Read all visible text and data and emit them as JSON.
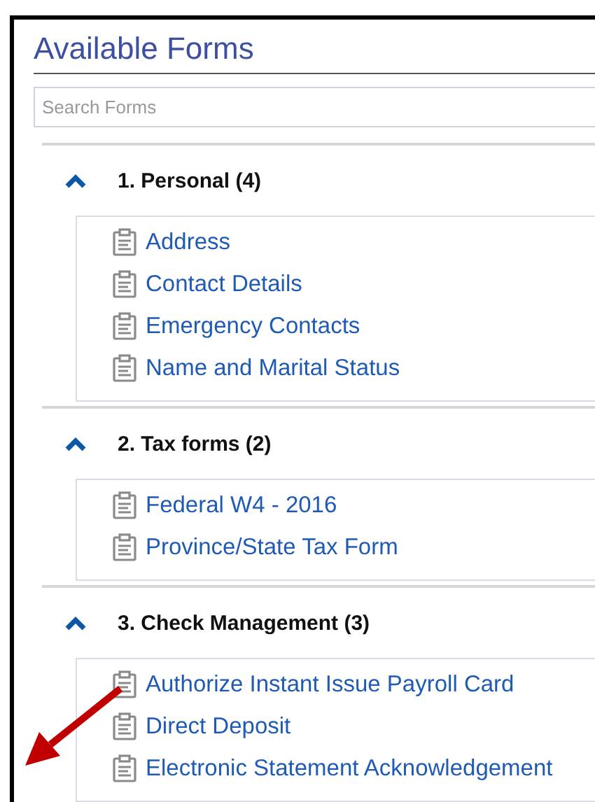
{
  "title": "Available Forms",
  "search": {
    "placeholder": "Search Forms"
  },
  "sections": [
    {
      "heading": "1. Personal (4)",
      "expanded": true,
      "forms": [
        "Address",
        "Contact Details",
        "Emergency Contacts",
        "Name and Marital Status"
      ]
    },
    {
      "heading": "2. Tax forms (2)",
      "expanded": true,
      "forms": [
        "Federal W4 - 2016",
        "Province/State Tax Form"
      ]
    },
    {
      "heading": "3. Check Management (3)",
      "expanded": true,
      "forms": [
        "Authorize Instant Issue Payroll Card",
        "Direct Deposit",
        "Electronic Statement Acknowledgement"
      ]
    }
  ]
}
